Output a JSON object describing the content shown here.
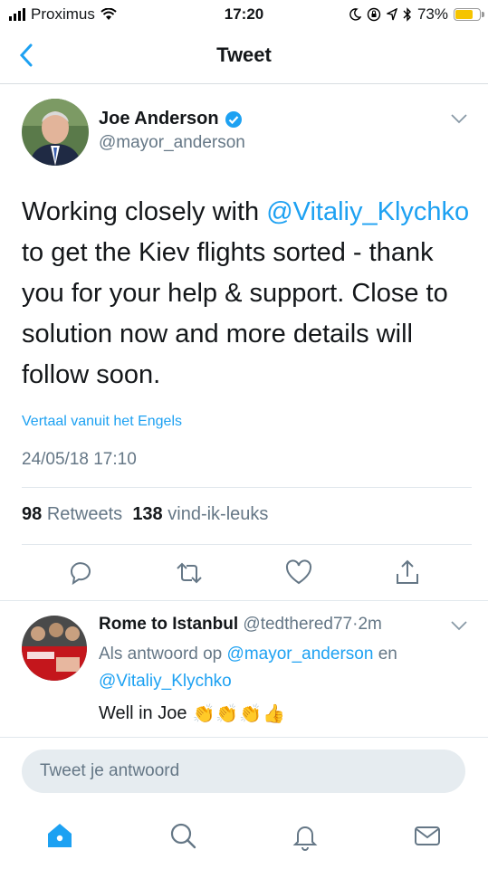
{
  "status_bar": {
    "carrier": "Proximus",
    "time": "17:20",
    "battery": "73%",
    "battery_level": 0.73,
    "battery_color": "#f5c400"
  },
  "nav": {
    "title": "Tweet",
    "back_icon": "chevron-left-icon"
  },
  "tweet": {
    "author_name": "Joe Anderson",
    "author_handle": "@mayor_anderson",
    "verified": true,
    "body_pre": "Working closely with ",
    "body_mention": "@Vitaliy_Klychko",
    "body_post": " to get the Kiev flights sorted - thank you for your help & support. Close to solution now and more details will follow soon.",
    "translate_label": "Vertaal vanuit het Engels",
    "timestamp": "24/05/18 17:10",
    "retweets_count": "98",
    "retweets_label": "Retweets",
    "likes_count": "138",
    "likes_label": "vind-ik-leuks"
  },
  "actions": [
    "reply-icon",
    "retweet-icon",
    "like-icon",
    "share-icon"
  ],
  "reply": {
    "author_name": "Rome to Istanbul",
    "author_handle": "@tedthered77",
    "separator": "·",
    "age": "2m",
    "context_prefix": "Als antwoord op",
    "context_user1": "@mayor_anderson",
    "context_join": "en",
    "context_user2": "@Vitaliy_Klychko",
    "text": "Well in Joe",
    "emoji": "👏👏👏👍"
  },
  "compose": {
    "placeholder": "Tweet je antwoord"
  },
  "tabbar": [
    "home-icon",
    "search-icon",
    "notifications-icon",
    "messages-icon"
  ],
  "colors": {
    "accent": "#1da1f2",
    "secondary_text": "#657786",
    "divider": "#e1e8ed"
  }
}
